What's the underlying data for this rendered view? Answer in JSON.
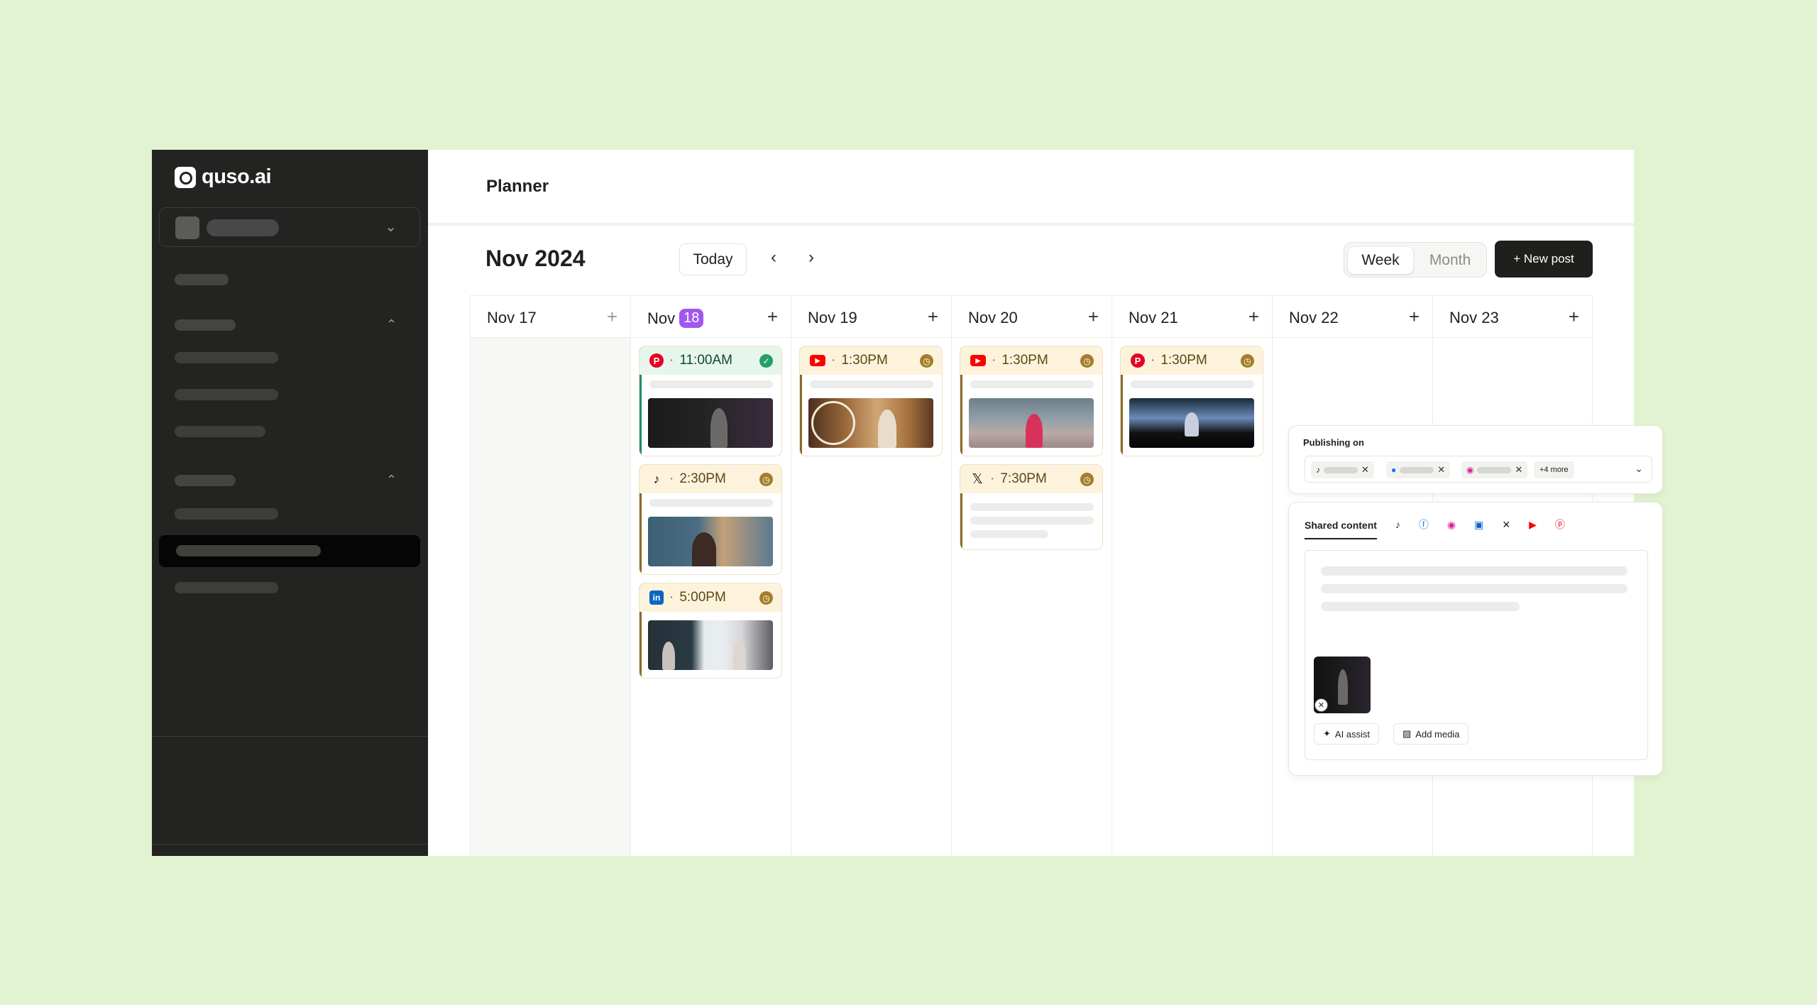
{
  "brand": {
    "name": "quso.ai"
  },
  "page": {
    "title": "Planner"
  },
  "toolbar": {
    "month_label": "Nov 2024",
    "prev_icon": "‹",
    "next_icon": "›",
    "today_label": "Today",
    "view_week": "Week",
    "view_month": "Month",
    "active_view": "Week",
    "new_post_label": "+ New post"
  },
  "days": [
    {
      "label": "Nov 17",
      "badge": ""
    },
    {
      "label": "Nov",
      "badge": "18"
    },
    {
      "label": "Nov 19",
      "badge": ""
    },
    {
      "label": "Nov 20",
      "badge": ""
    },
    {
      "label": "Nov 21",
      "badge": ""
    },
    {
      "label": "Nov 22",
      "badge": ""
    },
    {
      "label": "Nov 23",
      "badge": ""
    }
  ],
  "add_glyph": "+",
  "posts": [
    {
      "day": "Nov 18",
      "platform": "pinterest-icon",
      "time": "11:00AM",
      "status": "published"
    },
    {
      "day": "Nov 18",
      "platform": "tiktok-icon",
      "time": "2:30PM",
      "status": "scheduled"
    },
    {
      "day": "Nov 18",
      "platform": "linkedin-icon",
      "time": "5:00PM",
      "status": "scheduled"
    },
    {
      "day": "Nov 19",
      "platform": "youtube-icon",
      "time": "1:30PM",
      "status": "scheduled"
    },
    {
      "day": "Nov 20",
      "platform": "youtube-icon",
      "time": "1:30PM",
      "status": "scheduled"
    },
    {
      "day": "Nov 20",
      "platform": "x-icon",
      "time": "7:30PM",
      "status": "scheduled"
    },
    {
      "day": "Nov 21",
      "platform": "pinterest-icon",
      "time": "1:30PM",
      "status": "scheduled"
    }
  ],
  "publishing": {
    "label": "Publishing on",
    "chips": [
      "tiktok-icon",
      "facebook-icon",
      "instagram-icon"
    ],
    "more_label": "+4 more"
  },
  "editor": {
    "tab_label": "Shared content",
    "tab_icons": [
      "tiktok-icon",
      "facebook-icon",
      "instagram-icon",
      "linkedin-icon",
      "x-icon",
      "youtube-icon",
      "pinterest-icon"
    ],
    "ai_assist_label": "AI assist",
    "add_media_label": "Add media"
  },
  "colors": {
    "background": "#e2f3d2",
    "sidebar": "#232321",
    "accent_badge": "#a256f0",
    "scheduled": "#a47e29",
    "published": "#22a06b",
    "primary_button": "#1f201d"
  }
}
